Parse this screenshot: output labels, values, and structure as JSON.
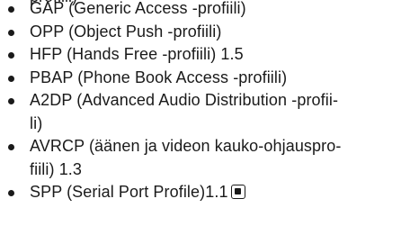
{
  "partial_top_line": "profiili)",
  "profiles": [
    {
      "lines": [
        "GAP (Generic Access -profiili)"
      ]
    },
    {
      "lines": [
        "OPP (Object Push -profiili)"
      ]
    },
    {
      "lines": [
        "HFP (Hands Free -profiili) 1.5"
      ]
    },
    {
      "lines": [
        "PBAP (Phone Book Access -profiili)"
      ]
    },
    {
      "lines": [
        "A2DP (Advanced Audio Distribution -profii-",
        "li)"
      ]
    },
    {
      "lines": [
        "AVRCP (äänen ja videon kauko-ohjauspro-",
        "fiili) 1.3"
      ]
    },
    {
      "lines": [
        "SPP (Serial Port Profile)1.1"
      ]
    }
  ],
  "end_mark_icon": "end-of-section-icon"
}
